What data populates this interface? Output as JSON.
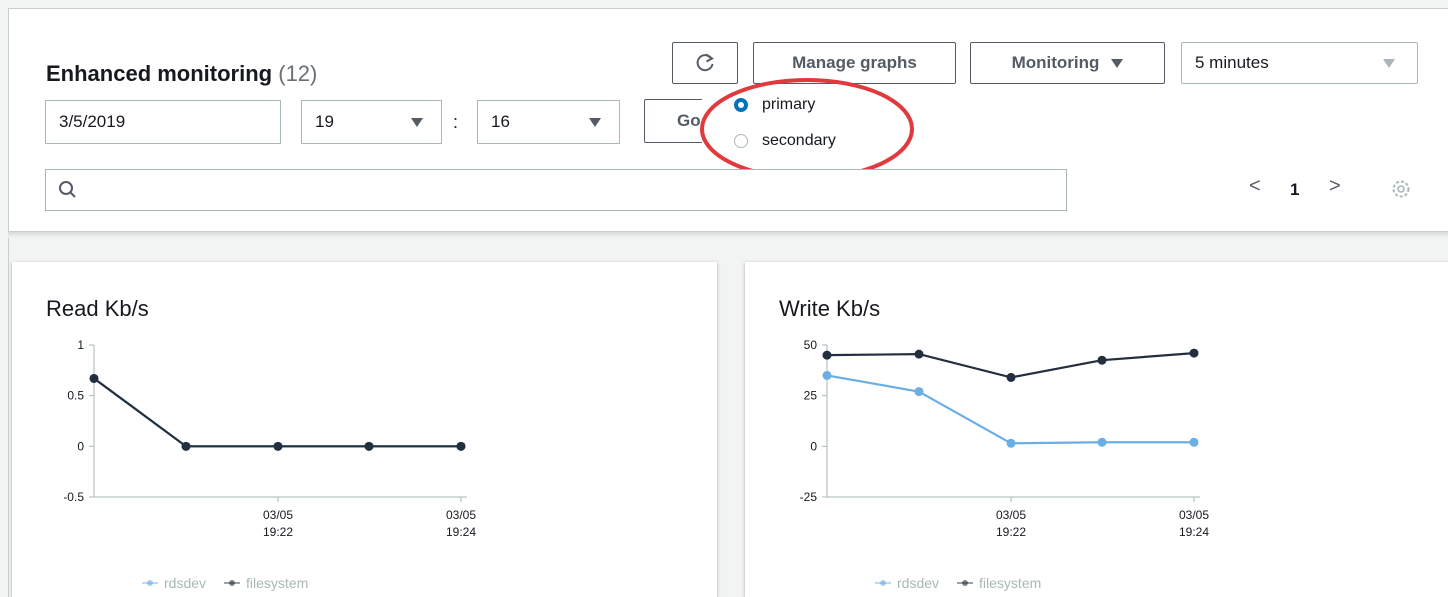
{
  "header": {
    "title": "Enhanced monitoring",
    "count": "(12)",
    "date_value": "3/5/2019",
    "hour_value": "19",
    "time_separator": ":",
    "minute_value": "16",
    "go_label": "Go",
    "refresh_icon": "refresh-icon",
    "manage_graphs_label": "Manage graphs",
    "monitoring_label": "Monitoring",
    "range_value": "5 minutes",
    "instance_options": [
      {
        "label": "primary",
        "selected": true
      },
      {
        "label": "secondary",
        "selected": false
      }
    ],
    "highlight_color": "#e0393e",
    "search_placeholder": "",
    "page_number": "1",
    "prev_glyph": "<",
    "next_glyph": ">"
  },
  "charts": [
    {
      "title": "Read Kb/s",
      "chart_data": {
        "type": "line",
        "ylim": [
          -0.5,
          1
        ],
        "yticks": [
          "1",
          "0.5",
          "0",
          "-0.5"
        ],
        "xticks": [
          [
            "03/05",
            "19:22"
          ],
          [
            "03/05",
            "19:24"
          ]
        ],
        "series": [
          {
            "name": "rdsdev",
            "color": "#6aaee5",
            "values": [
              0.67,
              0,
              0,
              0,
              0
            ]
          },
          {
            "name": "filesystem",
            "color": "#232f3e",
            "values": [
              0.67,
              0,
              0,
              0,
              0
            ]
          }
        ]
      }
    },
    {
      "title": "Write Kb/s",
      "chart_data": {
        "type": "line",
        "ylim": [
          -25,
          50
        ],
        "yticks": [
          "50",
          "25",
          "0",
          "-25"
        ],
        "xticks": [
          [
            "03/05",
            "19:22"
          ],
          [
            "03/05",
            "19:24"
          ]
        ],
        "series": [
          {
            "name": "rdsdev",
            "color": "#6aaee5",
            "values": [
              35,
              27,
              1.5,
              2,
              2
            ]
          },
          {
            "name": "filesystem",
            "color": "#232f3e",
            "values": [
              45,
              45.5,
              34,
              42.5,
              46
            ]
          }
        ]
      }
    }
  ]
}
